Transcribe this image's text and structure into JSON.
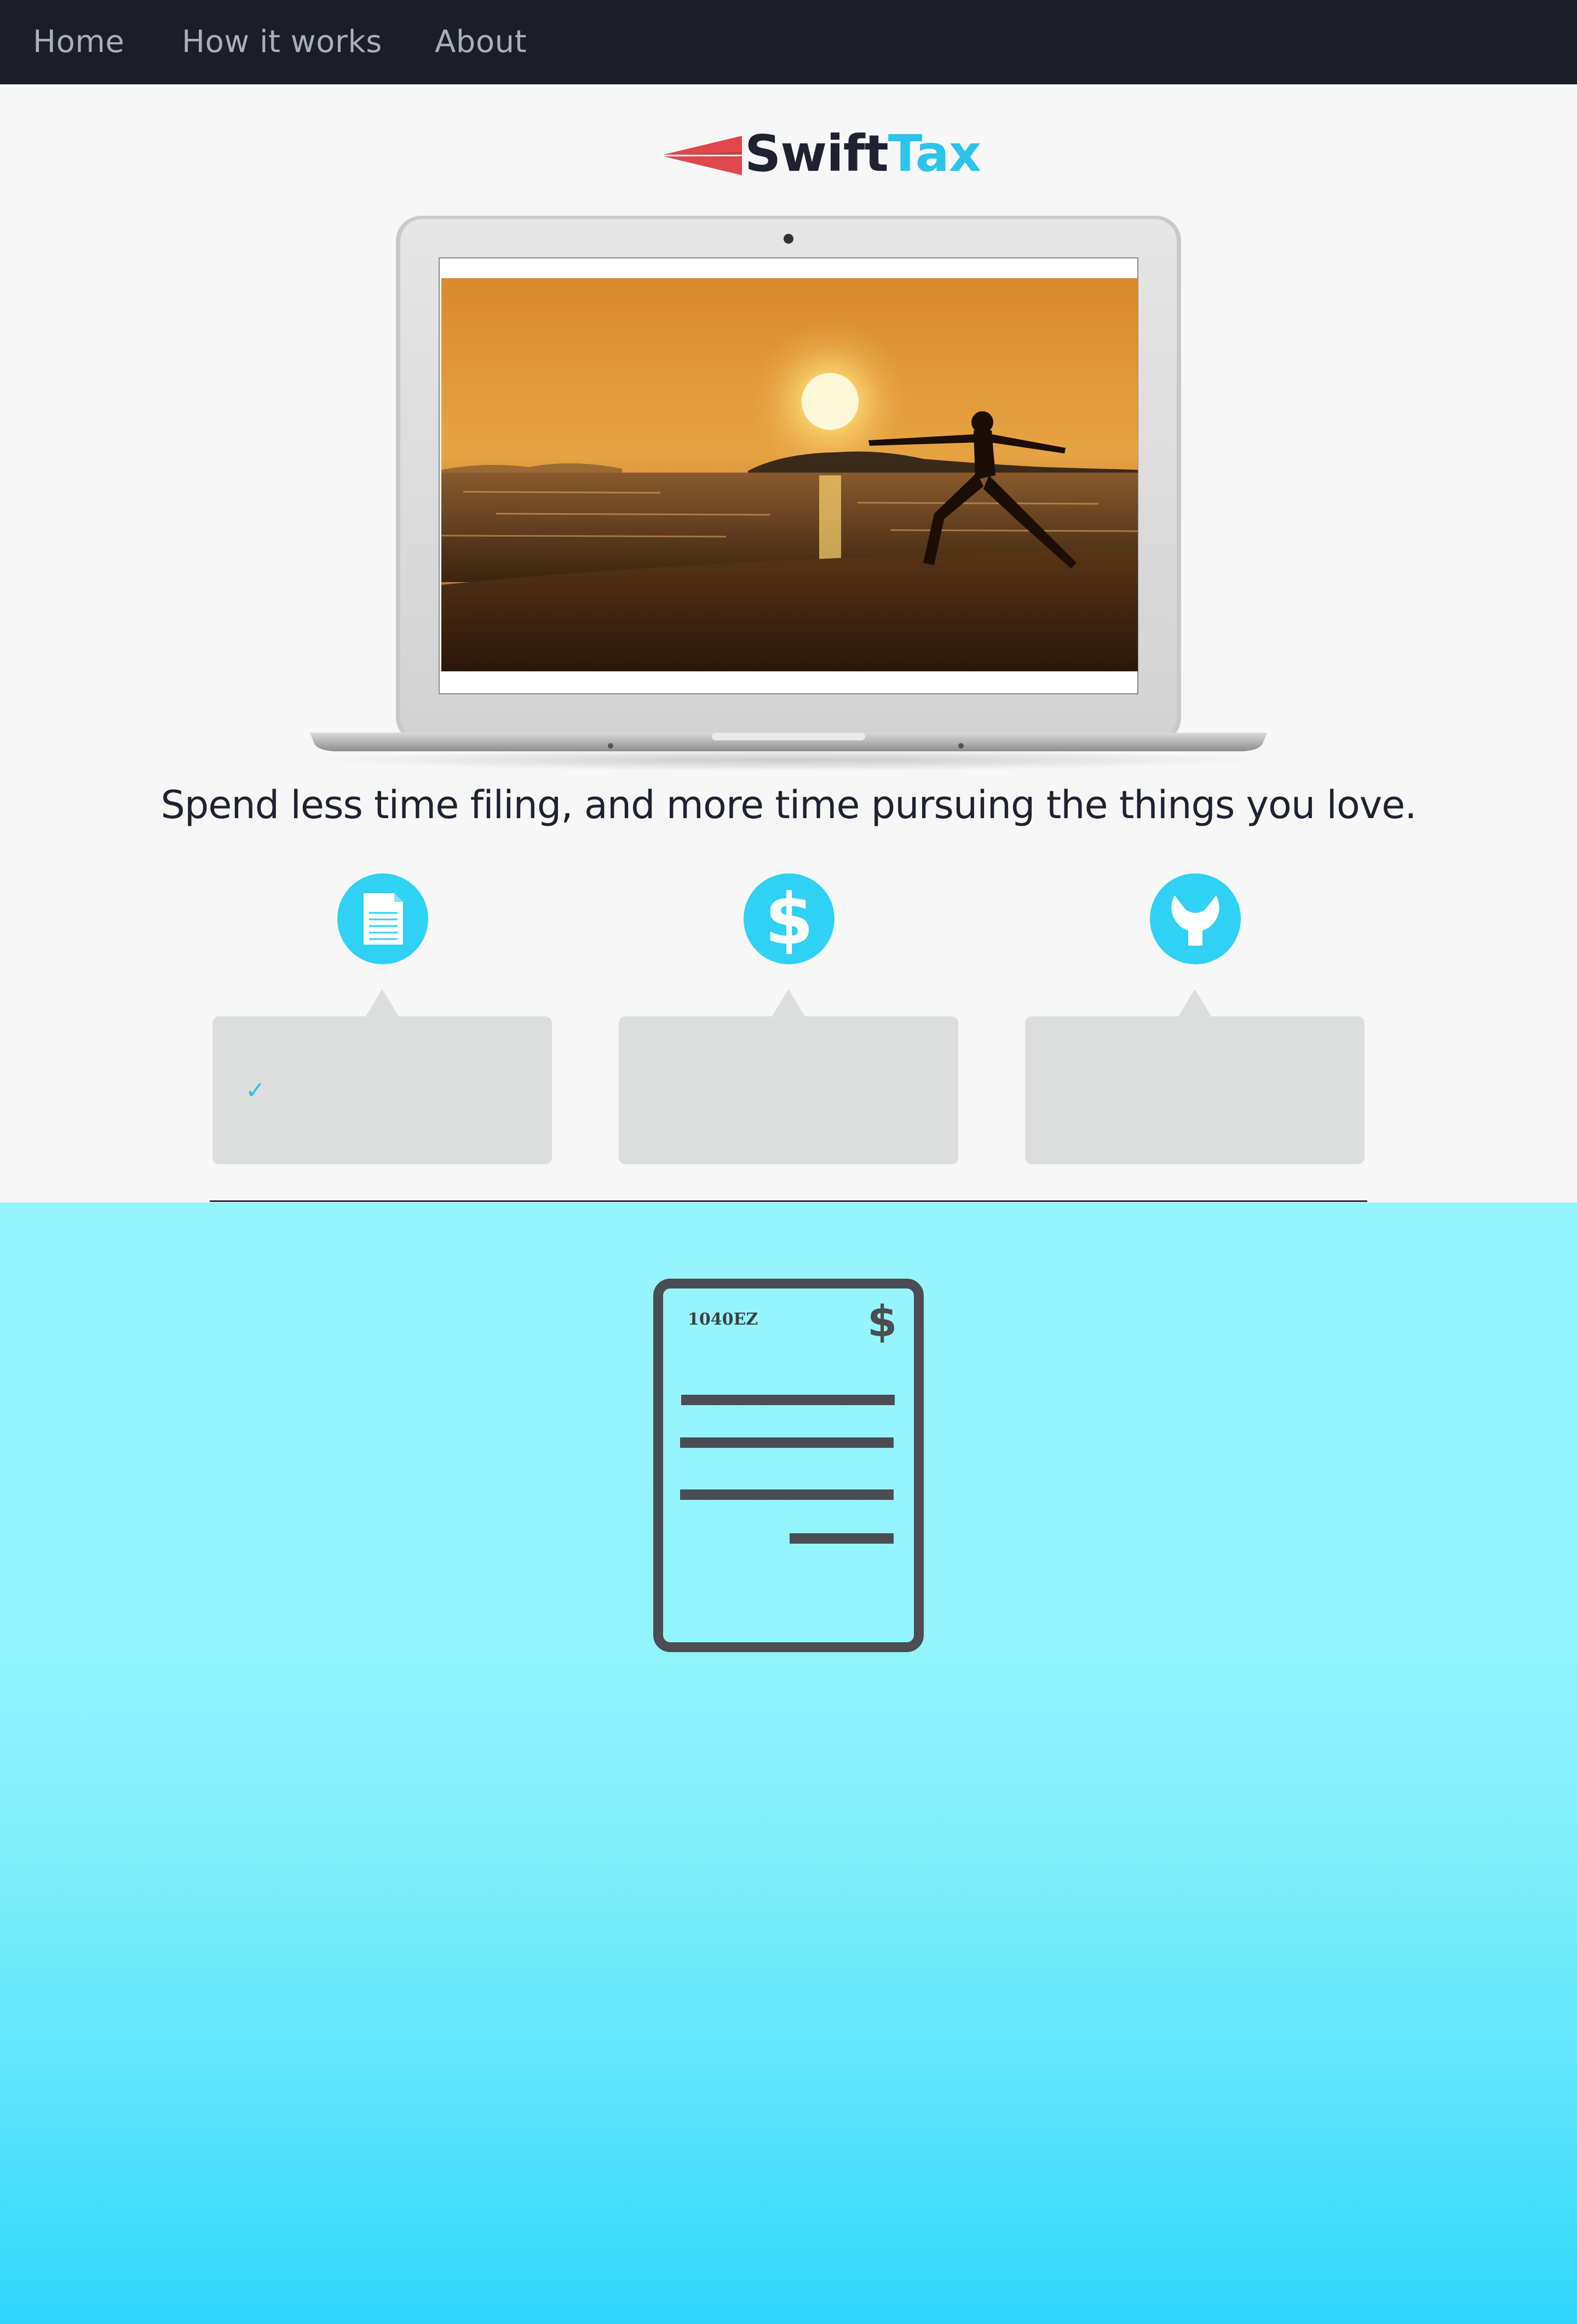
{
  "nav": {
    "items": [
      {
        "label": "Home"
      },
      {
        "label": "How it works"
      },
      {
        "label": "About"
      }
    ]
  },
  "logo": {
    "swift": "Swift",
    "tax": "Tax"
  },
  "hero": {
    "tagline": "Spend less time filing, and more time pursuing the things you love."
  },
  "features": [
    {
      "icon": "document-icon",
      "check": "✓"
    },
    {
      "icon": "dollar-icon",
      "check": ""
    },
    {
      "icon": "wrench-icon",
      "check": ""
    }
  ],
  "form_illustration": {
    "label": "1040EZ",
    "symbol": "$"
  },
  "colors": {
    "nav_bg": "#1b1e26",
    "accent": "#2bc4ea",
    "logo_dark": "#1f2230",
    "logo_red": "#e0474c",
    "card_bg": "#dcdddd",
    "gradient_top": "#96f5fc",
    "gradient_bottom": "#2fd7fb"
  }
}
